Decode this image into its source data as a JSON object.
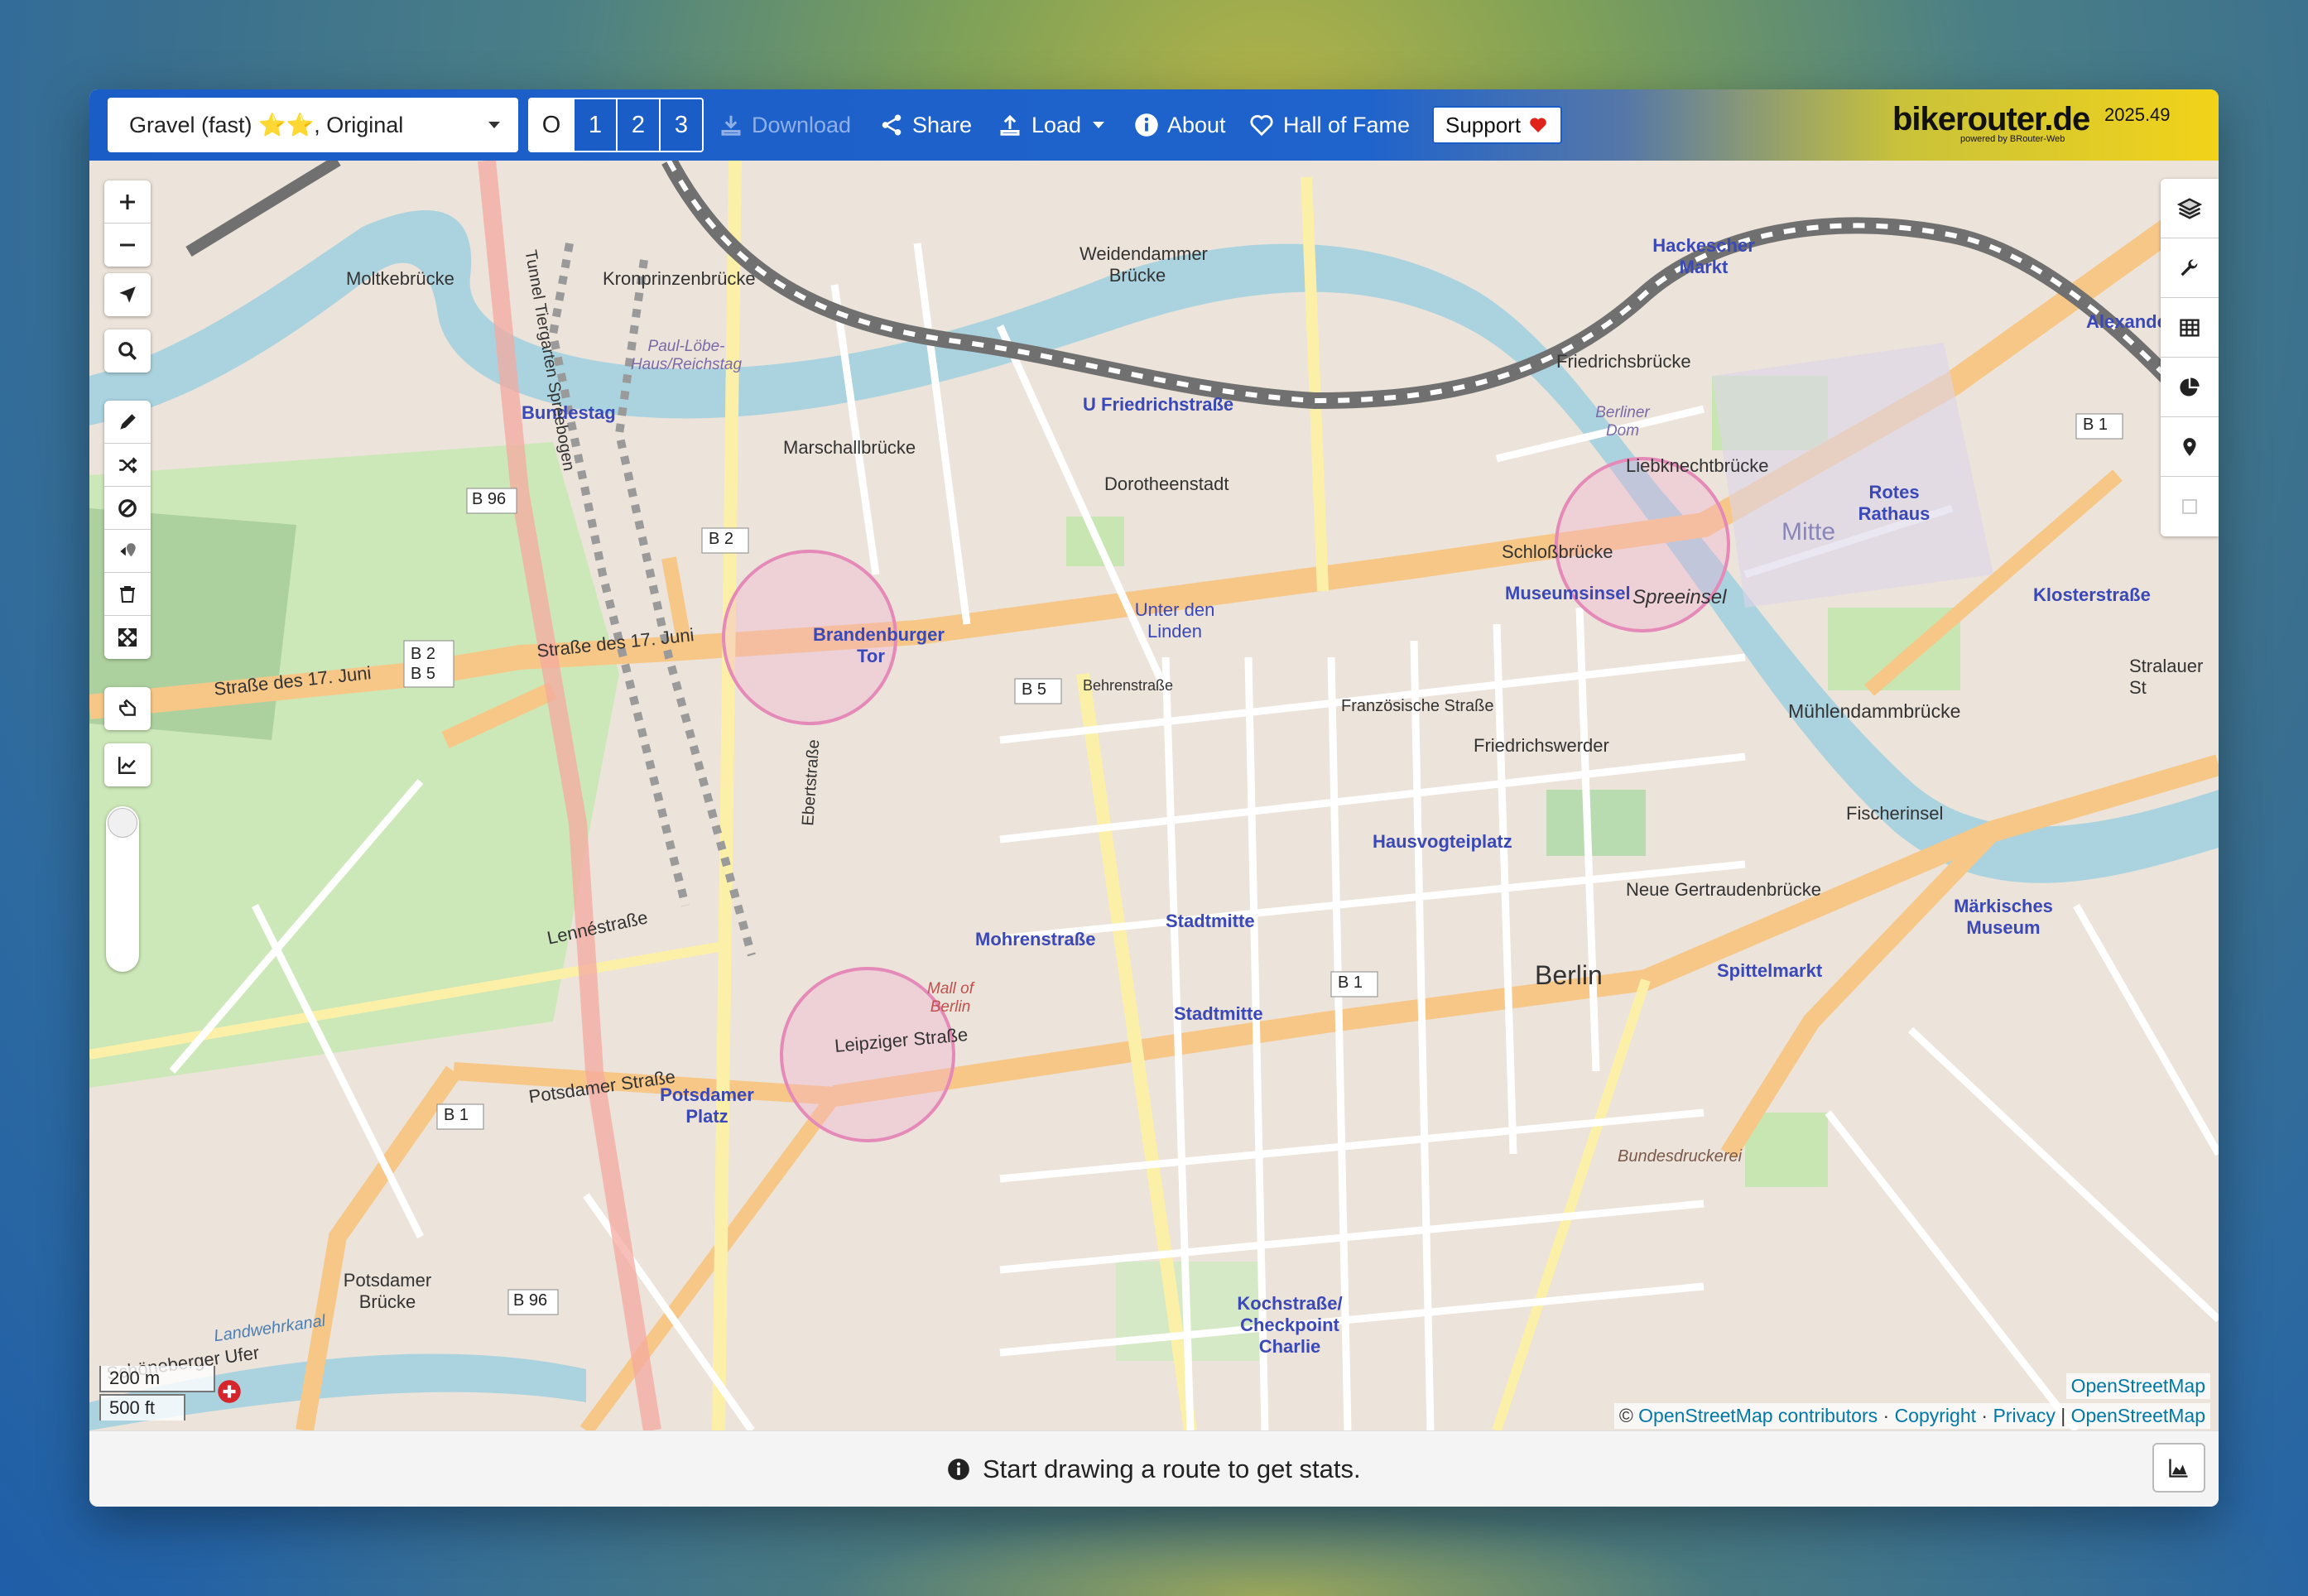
{
  "navbar": {
    "profile": "Gravel (fast) ⭐⭐, Original",
    "alternatives": [
      "O",
      "1",
      "2",
      "3"
    ],
    "download": "Download",
    "share": "Share",
    "load": "Load",
    "about": "About",
    "hall_of_fame": "Hall of Fame",
    "support": "Support",
    "brand": "bikerouter.de",
    "brand_sub": "powered by BRouter-Web",
    "version": "2025.49"
  },
  "map": {
    "labels": {
      "bundestag": "Bundestag",
      "brandenburger_tor": "Brandenburger Tor",
      "unter_den_linden": "Unter den Linden",
      "museumsinsel": "Museumsinsel",
      "schlossbruecke": "Schloßbrücke",
      "spreeinsel": "Spreeinsel",
      "mitte": "Mitte",
      "berlin": "Berlin",
      "potsdamer_platz": "Potsdamer Platz",
      "friedrichstrasse": "U Friedrichstraße",
      "hausvogteiplatz": "Hausvogteiplatz",
      "mohrenstrasse": "Mohrenstraße",
      "stadtmitte": "Stadtmitte",
      "spittelmarkt": "Spittelmarkt",
      "kochstrasse": "Kochstraße/ Checkpoint Charlie",
      "hackescher_markt": "Hackescher Markt",
      "rotes_rathaus": "Rotes Rathaus",
      "klosterstrasse": "Klosterstraße",
      "maerkisches_museum": "Märkisches Museum",
      "muehlendammbruecke": "Mühlendammbrücke",
      "fischerinsel": "Fischerinsel",
      "neue_gertraudenbruecke": "Neue Gertraudenbrücke",
      "strasse_17_juni": "Straße des 17. Juni",
      "leipziger_strasse": "Leipziger Straße",
      "potsdamer_strasse": "Potsdamer Straße",
      "moltkebruecke": "Moltkebrücke",
      "kronprinzenbruecke": "Kronprinzenbrücke",
      "marschallbruecke": "Marschallbrücke",
      "dorotheenstadt": "Dorotheenstadt",
      "weidendammer_bruecke": "Weidendammer Brücke",
      "friedrichsbruecke": "Friedrichsbrücke",
      "liebknechtbruecke": "Liebknechtbrücke",
      "friedrichswerder": "Friedrichswerder",
      "franzoesische_strasse": "Französische Straße",
      "behrenstrasse": "Behrenstraße",
      "lennestrasse": "Lennéstraße",
      "ebertstrasse": "Ebertstraße",
      "tunnel_tiergarten": "Tunnel Tiergarten Spreebogen",
      "mall_of_berlin": "Mall of Berlin",
      "potsdamer_bruecke": "Potsdamer Brücke",
      "schoeneberger_ufer": "Schöneberger Ufer",
      "landwehrkanal": "Landwehrkanal",
      "paul_loebe": "Paul-Löbe-Haus/Reichstag",
      "berliner_dom": "Berliner Dom",
      "alexanderplatz": "Alexande",
      "bundesdruckerei": "Bundesdruckerei",
      "stralauer": "Stralauer St",
      "b1": "B 1",
      "b2": "B 2",
      "b5": "B 5",
      "b96": "B 96",
      "b2b5": "B 2 B 5"
    },
    "scale": {
      "metric": "200 m",
      "imperial": "500 ft"
    },
    "attribution_top": "OpenStreetMap",
    "attribution": {
      "prefix": "©",
      "osm_contributors": "OpenStreetMap contributors",
      "copyright": "Copyright",
      "privacy": "Privacy",
      "osm": "OpenStreetMap"
    }
  },
  "footer": {
    "stats_text": "Start drawing a route to get stats."
  },
  "colors": {
    "navbar_blue": "#1b5dc7",
    "brand_yellow": "#f2d319",
    "highway_orange": "#f7c788",
    "water": "#aad3df",
    "park": "#c8e8b4"
  }
}
